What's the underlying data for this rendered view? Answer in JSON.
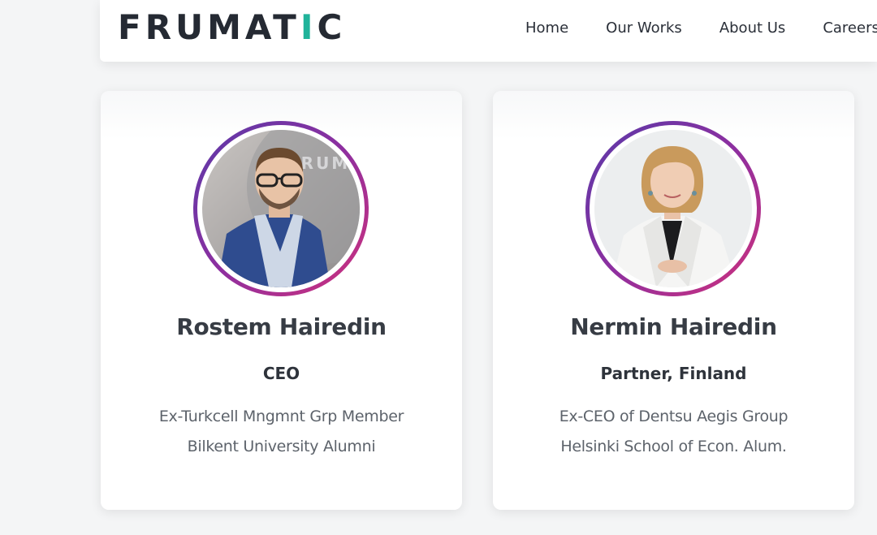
{
  "header": {
    "logo_main": "FRUMAT",
    "logo_accent": "I",
    "logo_tail": "C",
    "nav": [
      {
        "label": "Home"
      },
      {
        "label": "Our Works"
      },
      {
        "label": "About Us"
      },
      {
        "label": "Careers"
      }
    ]
  },
  "team": [
    {
      "name": "Rostem Hairedin",
      "role": "CEO",
      "line1": "Ex-Turkcell Mngmnt Grp Member",
      "line2": "Bilkent University Alumni",
      "photo_text": "FRUM"
    },
    {
      "name": "Nermin Hairedin",
      "role": "Partner, Finland",
      "line1": "Ex-CEO of Dentsu Aegis Group",
      "line2": "Helsinki School of Econ. Alum."
    }
  ],
  "colors": {
    "accent": "#20b39a",
    "ring_start": "#5a3aa8",
    "ring_end": "#d0307b",
    "text_dark": "#373c44"
  }
}
